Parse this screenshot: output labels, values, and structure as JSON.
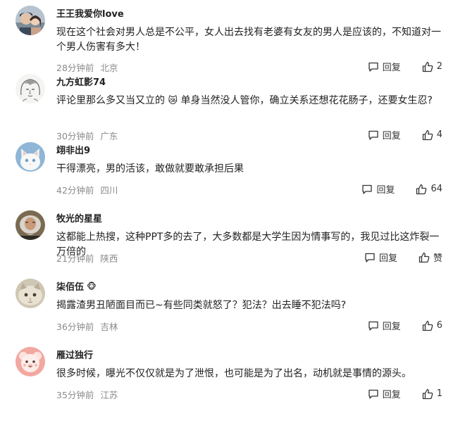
{
  "ui": {
    "reply_label": "回复"
  },
  "comments": [
    {
      "user": "王王我爱你love",
      "badge": "",
      "text": "现在这个社会对男人总是不公平，女人出去找有老婆有女友的男人是应该的，不知道对一个男人伤害有多大！",
      "emoji": "",
      "text_after": "",
      "time": "28分钟前",
      "location": "北京",
      "likes": "2"
    },
    {
      "user": "九方虹影74",
      "badge": "",
      "text": "评论里那么多又当又立的",
      "emoji": "😿",
      "text_after": "单身当然没人管你，确立关系还想花花肠子，还要女生忍?",
      "time": "30分钟前",
      "location": "广东",
      "likes": "4"
    },
    {
      "user": "翊非出9",
      "badge": "",
      "text": "干得漂亮，男的活该，敢做就要敢承担后果",
      "emoji": "",
      "text_after": "",
      "time": "42分钟前",
      "location": "四川",
      "likes": "64"
    },
    {
      "user": "牧光的星星",
      "badge": "",
      "text": "这都能上热搜，这种PPT多的去了，大多数都是大学生因为情事写的，我见过比这炸裂一万倍的",
      "emoji": "",
      "text_after": "",
      "time": "21分钟前",
      "location": "陕西",
      "likes": "赞"
    },
    {
      "user": "柒佰伍",
      "badge": "🐵",
      "text": "揭露渣男丑陋面目而已~有些同类就怒了？犯法？出去睡不犯法吗?",
      "emoji": "",
      "text_after": "",
      "time": "36分钟前",
      "location": "吉林",
      "likes": "6"
    },
    {
      "user": "雁过独行",
      "badge": "",
      "text": "很多时候，曝光不仅仅就是为了泄恨，也可能是为了出名，动机就是事情的源头。",
      "emoji": "",
      "text_after": "",
      "time": "35分钟前",
      "location": "江苏",
      "likes": "1"
    }
  ]
}
